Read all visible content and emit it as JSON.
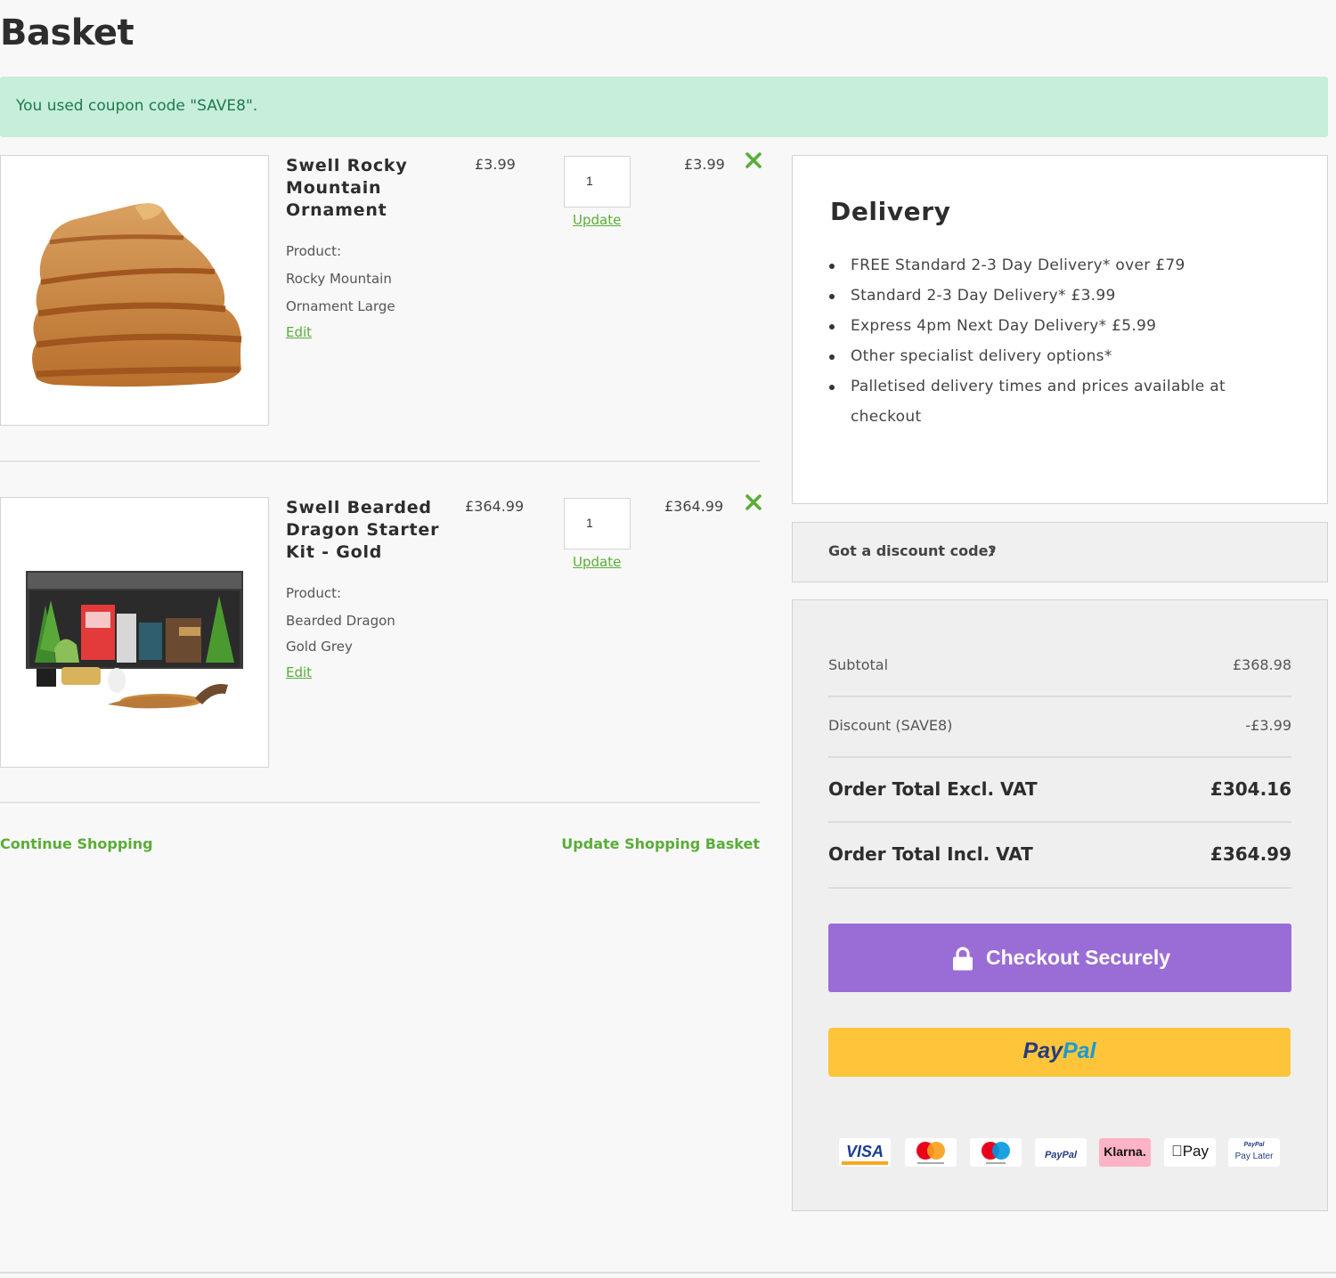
{
  "page": {
    "title": "Basket"
  },
  "coupon_message": "You used coupon code \"SAVE8\".",
  "items": [
    {
      "name": "Swell Rocky Mountain Ornament",
      "product_label": "Product:",
      "product_line1": "Rocky Mountain",
      "product_line2": "Ornament Large",
      "edit_label": "Edit",
      "price": "£3.99",
      "qty": "1",
      "update_label": "Update",
      "subtotal": "£3.99"
    },
    {
      "name": "Swell Bearded Dragon Starter Kit - Gold",
      "product_label": "Product:",
      "product_line1": "Bearded Dragon",
      "product_line2": "Gold Grey",
      "edit_label": "Edit",
      "price": "£364.99",
      "qty": "1",
      "update_label": "Update",
      "subtotal": "£364.99"
    }
  ],
  "actions": {
    "continue_shopping": "Continue Shopping",
    "update_basket": "Update Shopping Basket"
  },
  "delivery": {
    "title": "Delivery",
    "options": [
      "FREE Standard 2-3 Day Delivery* over £79",
      "Standard 2-3 Day Delivery* £3.99",
      "Express 4pm Next Day Delivery* £5.99",
      "Other specialist delivery options*",
      "Palletised delivery times and prices available at checkout"
    ]
  },
  "discount": {
    "label": "Got a discount code?"
  },
  "totals": {
    "subtotal_label": "Subtotal",
    "subtotal_value": "£368.98",
    "discount_label": "Discount (SAVE8)",
    "discount_value": "-£3.99",
    "excl_vat_label": "Order Total Excl. VAT",
    "excl_vat_value": "£304.16",
    "incl_vat_label": "Order Total Incl. VAT",
    "incl_vat_value": "£364.99"
  },
  "checkout": {
    "secure_label": "Checkout Securely",
    "paypal_pay": "Pay",
    "paypal_pal": "Pal"
  },
  "payment_methods": {
    "visa": "VISA",
    "paypal": "PayPal",
    "klarna": "Klarna.",
    "apple_pay": "Pay",
    "paypal_later_1": "PayPal",
    "paypal_later_2": "Pay Later"
  },
  "colors": {
    "accent_green": "#5aad38",
    "coupon_bg": "#c6eedb",
    "checkout_purple": "#9a6dd6",
    "paypal_yellow": "#ffc53a"
  }
}
